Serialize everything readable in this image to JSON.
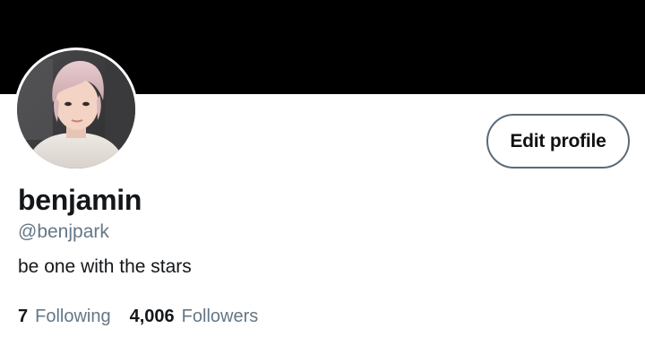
{
  "profile": {
    "display_name": "benjamin",
    "handle": "@benjpark",
    "bio": "be one with the stars",
    "edit_button_label": "Edit profile"
  },
  "stats": {
    "following_count": "7",
    "following_label": "Following",
    "followers_count": "4,006",
    "followers_label": "Followers"
  },
  "colors": {
    "banner": "#000000",
    "secondary_text": "#657786",
    "primary_text": "#14171a",
    "button_border": "#5b6b78"
  }
}
